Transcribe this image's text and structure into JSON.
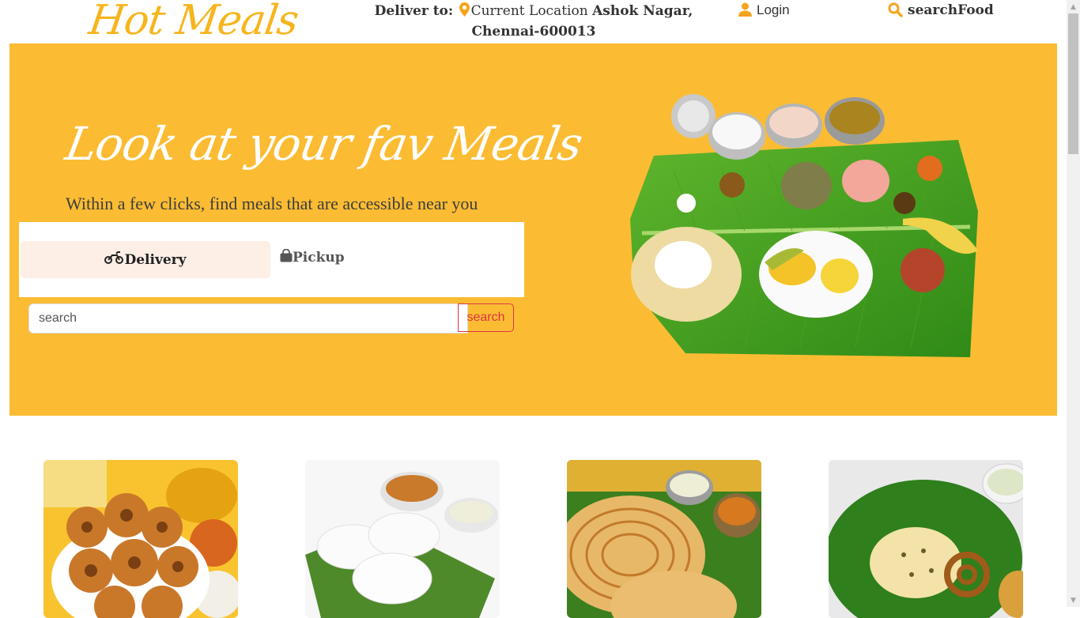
{
  "header": {
    "logo": "Hot Meals",
    "deliver_label": "Deliver to:",
    "current_location": "Current Location",
    "address": "Ashok Nagar, Chennai-600013",
    "login": "Login",
    "search_food": "searchFood"
  },
  "hero": {
    "title": "Look at your fav Meals",
    "subtitle": "Within a few clicks, find meals that are accessible near you",
    "tab_delivery": "Delivery",
    "tab_pickup": "Pickup",
    "search_placeholder": "search",
    "search_button": "search"
  },
  "colors": {
    "brand_yellow": "#fbbc33",
    "logo_orange": "#f7b51d",
    "search_red": "#dc3545",
    "leaf_green": "#3e9a1e"
  },
  "icons": {
    "pin": "map-pin-icon",
    "user": "user-icon",
    "search": "magnifier-icon",
    "motorcycle": "motorcycle-icon",
    "bag": "shopping-bag-icon"
  }
}
